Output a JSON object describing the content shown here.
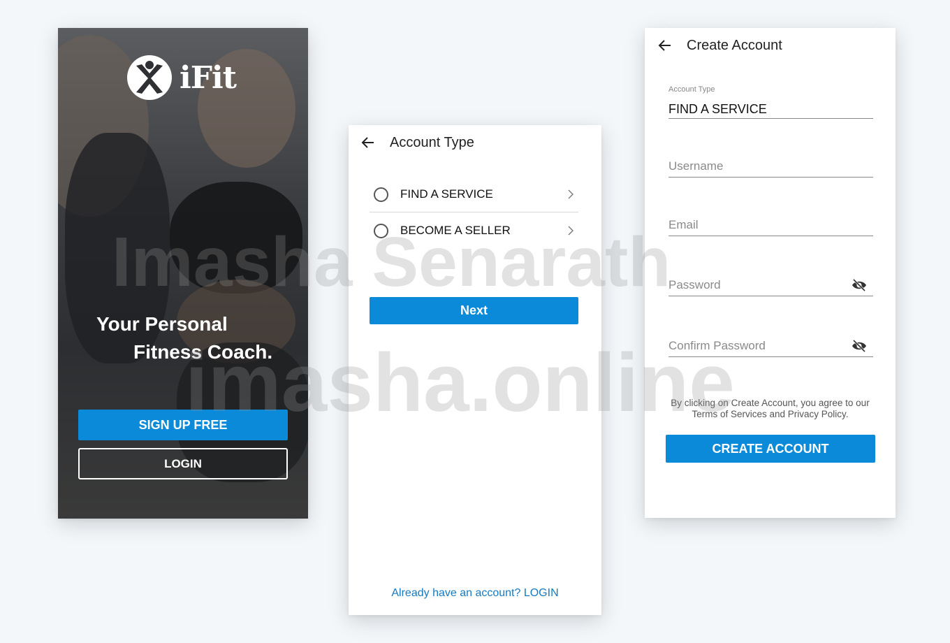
{
  "splash": {
    "logo_text": "iFit",
    "tagline_line1": "Your Personal",
    "tagline_line2": "Fitness Coach.",
    "signup_label": "SIGN UP FREE",
    "login_label": "LOGIN"
  },
  "account_type": {
    "title": "Account Type",
    "options": [
      {
        "label": "FIND A SERVICE"
      },
      {
        "label": "BECOME A SELLER"
      }
    ],
    "next_label": "Next",
    "login_link": "Already have an account? LOGIN"
  },
  "create_account": {
    "title": "Create Account",
    "account_type_label": "Account Type",
    "account_type_value": "FIND A SERVICE",
    "username_placeholder": "Username",
    "email_placeholder": "Email",
    "password_placeholder": "Password",
    "confirm_password_placeholder": "Confirm Password",
    "terms_line1": "By clicking on Create Account, you agree to our",
    "terms_line2": "Terms of Services and Privacy Policy.",
    "create_label": "CREATE ACCOUNT"
  },
  "watermark": {
    "line1": "Imasha Senarath",
    "line2": "imasha.online"
  },
  "colors": {
    "accent": "#0b8ad9",
    "link": "#157ac2",
    "background": "#f3f7fa"
  }
}
